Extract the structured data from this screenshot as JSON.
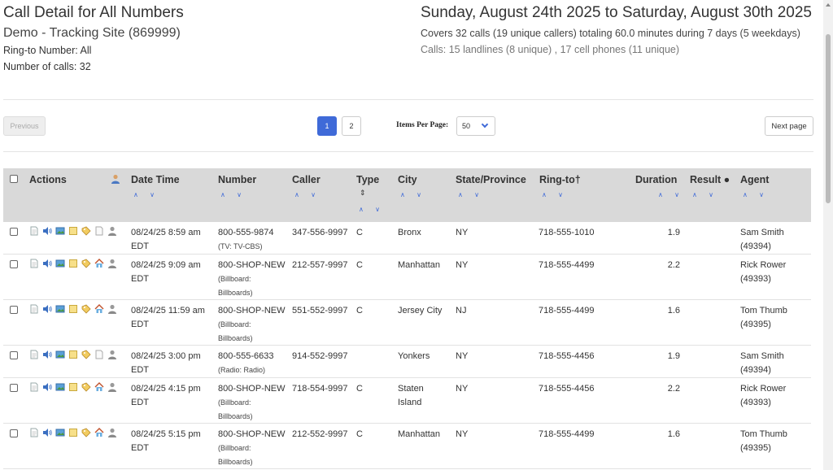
{
  "header": {
    "title": "Call Detail for All Numbers",
    "site": "Demo - Tracking Site (869999)",
    "ring_to": "Ring-to Number: All",
    "num_calls": "Number of calls: 32",
    "date_range": "Sunday, August 24th 2025 to Saturday, August 30th 2025",
    "covers": "Covers 32 calls (19 unique callers) totaling 60.0 minutes during 7 days (5 weekdays)",
    "calls_breakdown": "Calls: 15 landlines (8 unique) , 17 cell phones (11 unique)"
  },
  "pagination": {
    "previous_label": "Previous",
    "pages": [
      "1",
      "2"
    ],
    "current_page": "1",
    "items_per_page_label": "Items Per Page:",
    "items_per_page_value": "50",
    "next_label": "Next page"
  },
  "columns": {
    "actions": "Actions",
    "datetime": "Date Time",
    "number": "Number",
    "caller": "Caller",
    "type": "Type",
    "city": "City",
    "state": "State/Province",
    "ringto": "Ring-to†",
    "duration": "Duration",
    "result": "Result ●",
    "agent": "Agent",
    "sort_arrows": "∧ ∨",
    "type_sort_mark": "⇕"
  },
  "rows": [
    {
      "dt1": "08/24/25 8:59 am",
      "dt2": "EDT",
      "number": "800-555-9874",
      "src1": "(TV: TV-CBS)",
      "src2": "",
      "caller": "347-556-9997",
      "type": "C",
      "city1": "Bronx",
      "city2": "",
      "state": "NY",
      "ringto": "718-555-1010",
      "duration": "1.9",
      "agent1": "Sam Smith",
      "agent2": "(49394)"
    },
    {
      "dt1": "08/24/25 9:09 am",
      "dt2": "EDT",
      "number": "800-SHOP-NEW",
      "src1": "(Billboard:",
      "src2": "Billboards)",
      "caller": "212-557-9997",
      "type": "C",
      "city1": "Manhattan",
      "city2": "",
      "state": "NY",
      "ringto": "718-555-4499",
      "duration": "2.2",
      "agent1": "Rick Rower",
      "agent2": "(49393)"
    },
    {
      "dt1": "08/24/25 11:59 am",
      "dt2": "EDT",
      "number": "800-SHOP-NEW",
      "src1": "(Billboard:",
      "src2": "Billboards)",
      "caller": "551-552-9997",
      "type": "C",
      "city1": "Jersey City",
      "city2": "",
      "state": "NJ",
      "ringto": "718-555-4499",
      "duration": "1.6",
      "agent1": "Tom Thumb",
      "agent2": "(49395)"
    },
    {
      "dt1": "08/24/25 3:00 pm",
      "dt2": "EDT",
      "number": "800-555-6633",
      "src1": "(Radio: Radio)",
      "src2": "",
      "caller": "914-552-9997",
      "type": "",
      "city1": "Yonkers",
      "city2": "",
      "state": "NY",
      "ringto": "718-555-4456",
      "duration": "1.9",
      "agent1": "Sam Smith",
      "agent2": "(49394)"
    },
    {
      "dt1": "08/24/25 4:15 pm",
      "dt2": "EDT",
      "number": "800-SHOP-NEW",
      "src1": "(Billboard:",
      "src2": "Billboards)",
      "caller": "718-554-9997",
      "type": "C",
      "city1": "Staten",
      "city2": "Island",
      "state": "NY",
      "ringto": "718-555-4456",
      "duration": "2.2",
      "agent1": "Rick Rower",
      "agent2": "(49393)"
    },
    {
      "dt1": "08/24/25 5:15 pm",
      "dt2": "EDT",
      "number": "800-SHOP-NEW",
      "src1": "(Billboard:",
      "src2": "Billboards)",
      "caller": "212-552-9997",
      "type": "C",
      "city1": "Manhattan",
      "city2": "",
      "state": "NY",
      "ringto": "718-555-4499",
      "duration": "1.6",
      "agent1": "Tom Thumb",
      "agent2": "(49395)"
    }
  ],
  "colors": {
    "accent": "#3f6ad8",
    "header_bg": "#d9d9d9"
  },
  "icons": [
    "page-icon",
    "speaker-icon",
    "photo-icon",
    "note-icon",
    "tag-icon",
    "house-icon",
    "person-icon"
  ]
}
